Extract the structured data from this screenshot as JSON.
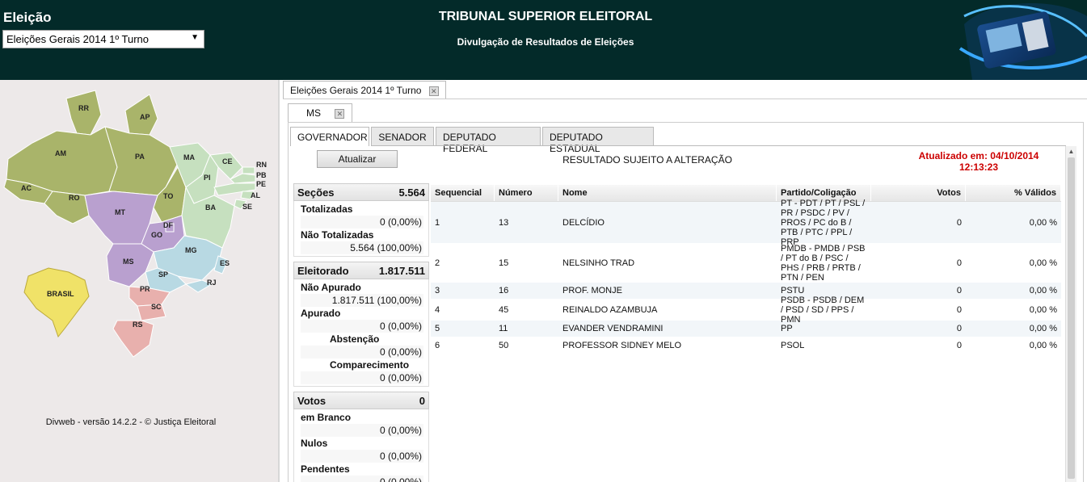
{
  "header": {
    "eleicao_label": "Eleição",
    "select_value": "Eleições Gerais 2014 1º Turno",
    "title": "TRIBUNAL SUPERIOR ELEITORAL",
    "subtitle": "Divulgação de Resultados de Eleições"
  },
  "map": {
    "states": [
      "RR",
      "AP",
      "AM",
      "PA",
      "MA",
      "CE",
      "RN",
      "PB",
      "PE",
      "AL",
      "SE",
      "PI",
      "AC",
      "RO",
      "TO",
      "BA",
      "MT",
      "DF",
      "GO",
      "MG",
      "ES",
      "MS",
      "SP",
      "RJ",
      "PR",
      "SC",
      "RS"
    ],
    "brasil_label": "BRASIL",
    "footer": "Divweb - versão 14.2.2 - © Justiça Eleitoral"
  },
  "tabs": {
    "outer_label": "Eleições Gerais 2014 1º Turno",
    "state_label": "MS",
    "subtabs": [
      "GOVERNADOR",
      "SENADOR",
      "DEPUTADO FEDERAL",
      "DEPUTADO ESTADUAL"
    ]
  },
  "toolbar": {
    "atualizar": "Atualizar",
    "sujeito": "RESULTADO SUJEITO A ALTERAÇÃO",
    "atualizado_line1": "Atualizado em: 04/10/2014",
    "atualizado_line2": "12:13:23"
  },
  "summary": {
    "secoes_label": "Seções",
    "secoes_value": "5.564",
    "totalizadas_label": "Totalizadas",
    "totalizadas_value": "0 (0,00%)",
    "nao_totalizadas_label": "Não Totalizadas",
    "nao_totalizadas_value": "5.564 (100,00%)",
    "eleitorado_label": "Eleitorado",
    "eleitorado_value": "1.817.511",
    "nao_apurado_label": "Não Apurado",
    "nao_apurado_value": "1.817.511 (100,00%)",
    "apurado_label": "Apurado",
    "apurado_value": "0 (0,00%)",
    "abstencao_label": "Abstenção",
    "abstencao_value": "0 (0,00%)",
    "comparecimento_label": "Comparecimento",
    "comparecimento_value": "0 (0,00%)",
    "votos_label": "Votos",
    "votos_value": "0",
    "branco_label": "em Branco",
    "branco_value": "0 (0,00%)",
    "nulos_label": "Nulos",
    "nulos_value": "0 (0,00%)",
    "pendentes_label": "Pendentes",
    "pendentes_value": "0 (0,00%)"
  },
  "table": {
    "headers": [
      "Sequencial",
      "Número",
      "Nome",
      "Partido/Coligação",
      "Votos",
      "% Válidos"
    ],
    "rows": [
      {
        "seq": "1",
        "num": "13",
        "nome": "DELCÍDIO",
        "partido": "PT - PDT / PT / PSL / PR / PSDC / PV / PROS / PC do B / PTB / PTC / PPL / PRP",
        "votos": "0",
        "pct": "0,00 %"
      },
      {
        "seq": "2",
        "num": "15",
        "nome": "NELSINHO TRAD",
        "partido": "PMDB - PMDB / PSB / PT do B / PSC / PHS / PRB / PRTB / PTN / PEN",
        "votos": "0",
        "pct": "0,00 %"
      },
      {
        "seq": "3",
        "num": "16",
        "nome": "PROF. MONJE",
        "partido": "PSTU",
        "votos": "0",
        "pct": "0,00 %"
      },
      {
        "seq": "4",
        "num": "45",
        "nome": "REINALDO AZAMBUJA",
        "partido": "PSDB - PSDB / DEM / PSD / SD / PPS / PMN",
        "votos": "0",
        "pct": "0,00 %"
      },
      {
        "seq": "5",
        "num": "11",
        "nome": "EVANDER VENDRAMINI",
        "partido": "PP",
        "votos": "0",
        "pct": "0,00 %"
      },
      {
        "seq": "6",
        "num": "50",
        "nome": "PROFESSOR SIDNEY MELO",
        "partido": "PSOL",
        "votos": "0",
        "pct": "0,00 %"
      }
    ]
  }
}
